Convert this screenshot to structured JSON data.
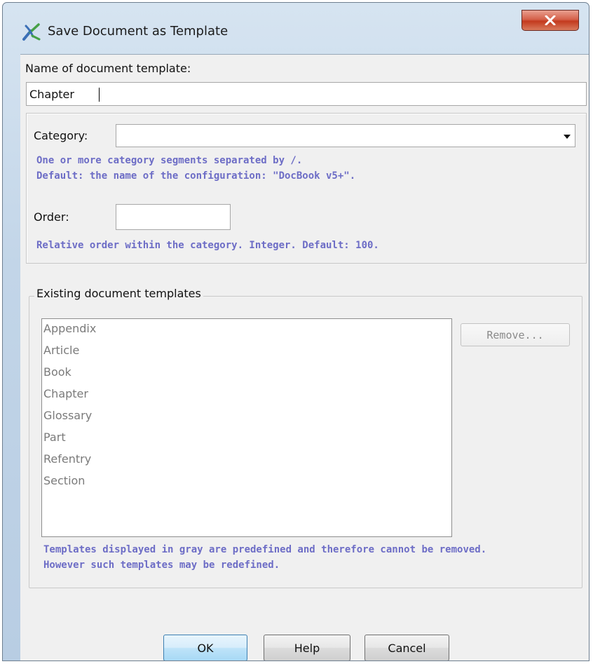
{
  "window": {
    "title": "Save Document as Template"
  },
  "name_field": {
    "label": "Name of document template:",
    "value": "Chapter"
  },
  "category": {
    "label": "Category:",
    "value": "",
    "hint_line1": "One or more category segments separated by /.",
    "hint_line2": "Default: the name of the configuration: \"DocBook v5+\"."
  },
  "order": {
    "label": "Order:",
    "value": "",
    "hint": "Relative order within the category. Integer. Default: 100."
  },
  "existing": {
    "legend": "Existing document templates",
    "items": [
      "Appendix",
      "Article",
      "Book",
      "Chapter",
      "Glossary",
      "Part",
      "Refentry",
      "Section"
    ],
    "remove_label": "Remove...",
    "note_line1": "Templates displayed in gray are predefined and therefore cannot be removed.",
    "note_line2": "However such templates may be redefined."
  },
  "buttons": {
    "ok": "OK",
    "help": "Help",
    "cancel": "Cancel"
  },
  "colors": {
    "hint_text": "#6d6dc6",
    "predefined_item": "#7a7a7a",
    "close_button": "#c33a1e"
  },
  "icons": {
    "app": "oxygen-logo-icon",
    "close": "close-icon",
    "dropdown": "chevron-down-icon"
  }
}
